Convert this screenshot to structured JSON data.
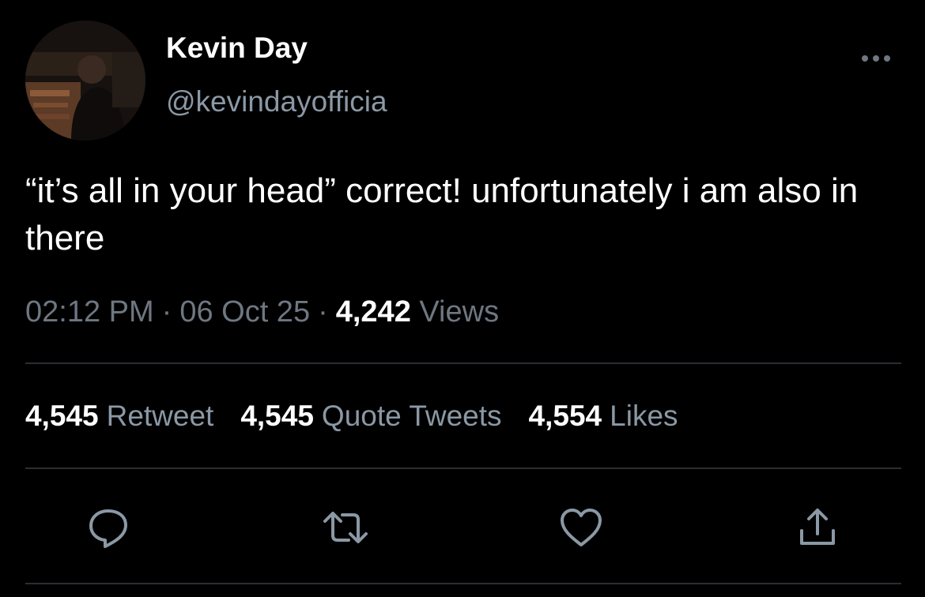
{
  "colors": {
    "background": "#000000",
    "primary_text": "#ffffff",
    "secondary_text": "#8b98a5",
    "divider": "#2a2d31"
  },
  "author": {
    "display_name": "Kevin Day",
    "handle": "@kevindayofficia"
  },
  "tweet": {
    "text": "“it’s all in your head” correct! unfortunately i am also in there",
    "time": "02:12 PM",
    "date": "06 Oct 25",
    "views_count": "4,242",
    "views_label": "Views"
  },
  "stats": {
    "retweets_count": "4,545",
    "retweets_label": "Retweet",
    "quotes_count": "4,545",
    "quotes_label": "Quote Tweets",
    "likes_count": "4,554",
    "likes_label": "Likes"
  },
  "icons": {
    "more": "more-horizontal-icon",
    "reply": "reply-icon",
    "retweet": "retweet-icon",
    "like": "heart-icon",
    "share": "share-icon"
  }
}
